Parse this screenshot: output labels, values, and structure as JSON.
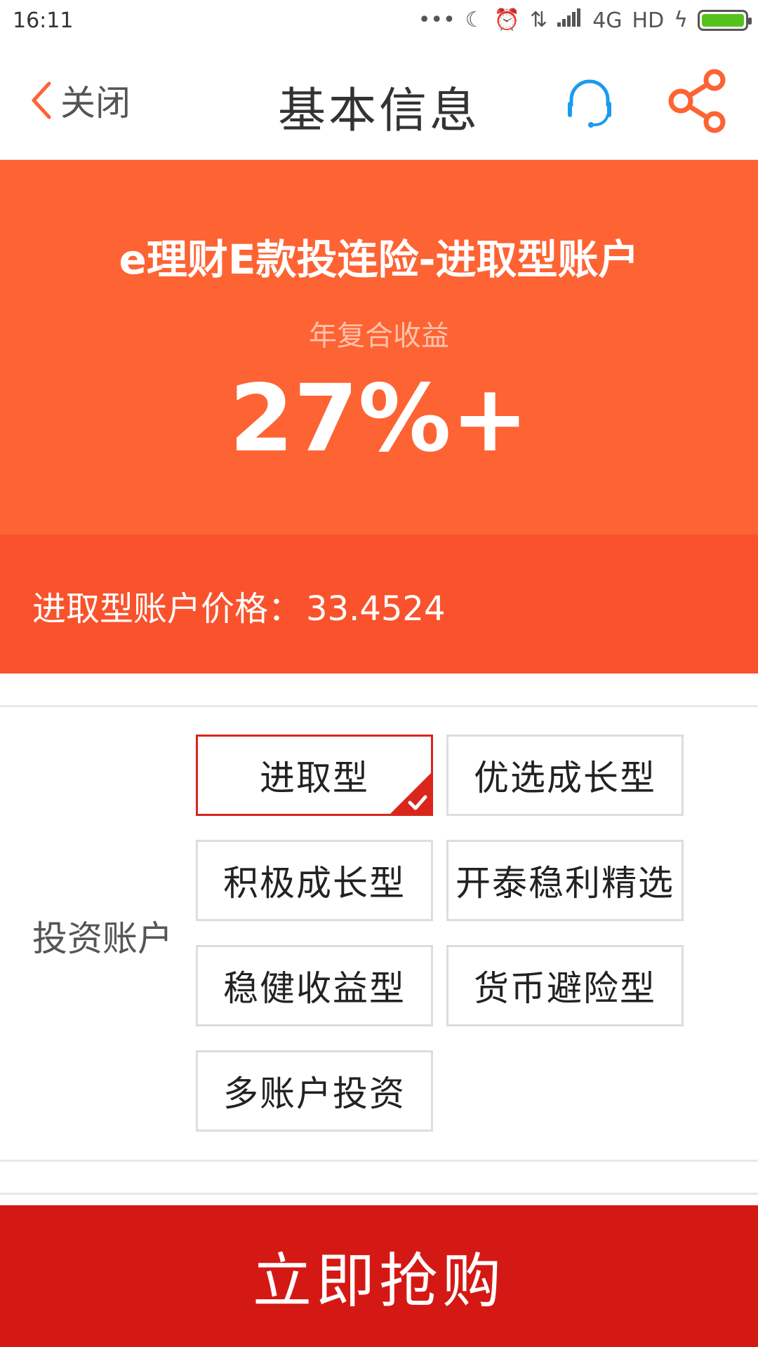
{
  "status_bar": {
    "time": "16:11",
    "network": "4G",
    "quality": "HD",
    "icons": [
      "more-dots-icon",
      "moon-icon",
      "alarm-icon",
      "data-arrows-icon",
      "signal-icon",
      "charging-icon",
      "battery-icon"
    ],
    "battery_color": "#55c21b"
  },
  "nav": {
    "back_label": "关闭",
    "title": "基本信息",
    "service_icon": "headset-icon",
    "share_icon": "share-icon",
    "accent_color": "#fe6333",
    "service_color": "#1a9bf0"
  },
  "hero": {
    "product_name": "e理财E款投连险-进取型账户",
    "yield_label": "年复合收益",
    "yield_value": "27%+",
    "background": "#fe6333"
  },
  "price": {
    "label": "进取型账户价格：",
    "value": "33.4524",
    "background": "#f9522c"
  },
  "accounts": {
    "label": "投资账户",
    "options": [
      {
        "label": "进取型",
        "selected": true
      },
      {
        "label": "优选成长型",
        "selected": false
      },
      {
        "label": "积极成长型",
        "selected": false
      },
      {
        "label": "开泰稳利精选",
        "selected": false
      },
      {
        "label": "稳健收益型",
        "selected": false
      },
      {
        "label": "货币避险型",
        "selected": false
      },
      {
        "label": "多账户投资",
        "selected": false
      }
    ],
    "selected_color": "#d9261c"
  },
  "buy": {
    "label": "立即抢购",
    "background": "#d41915"
  }
}
